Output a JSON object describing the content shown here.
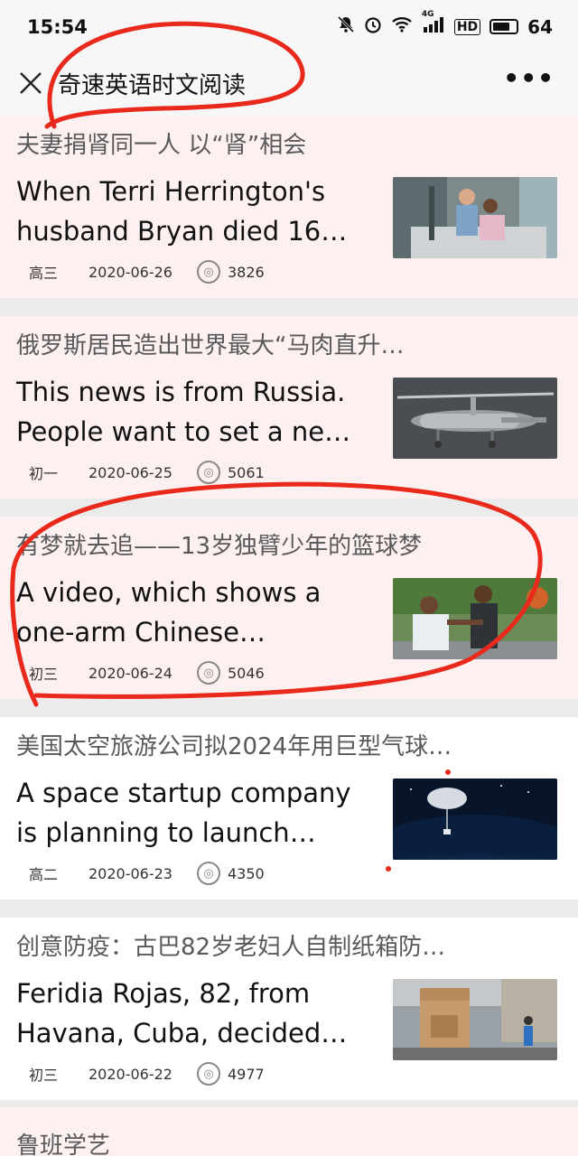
{
  "status": {
    "time": "15:54",
    "signal_label": "4G",
    "hd_label": "HD",
    "battery": "64"
  },
  "nav": {
    "title": "奇速英语时文阅读",
    "close": "×",
    "more": "•••"
  },
  "articles": [
    {
      "title": "夫妻捐肾同一人 以“肾”相会",
      "summary": "When Terri Herrington's husband Bryan died 16…",
      "grade": "高三",
      "date": "2020-06-26",
      "views": "3826"
    },
    {
      "title": "俄罗斯居民造出世界最大“马肉直升…",
      "summary": "This news is from Russia. People want to set a ne…",
      "grade": "初一",
      "date": "2020-06-25",
      "views": "5061"
    },
    {
      "title": "有梦就去追——13岁独臂少年的篮球梦",
      "summary": "A video, which shows a one-arm Chinese…",
      "grade": "初三",
      "date": "2020-06-24",
      "views": "5046"
    },
    {
      "title": "美国太空旅游公司拟2024年用巨型气球…",
      "summary": "A space startup company is planning to launch…",
      "grade": "高二",
      "date": "2020-06-23",
      "views": "4350"
    },
    {
      "title": "创意防疫：古巴82岁老妇人自制纸箱防…",
      "summary": "Feridia Rojas, 82, from Havana, Cuba, decided…",
      "grade": "初三",
      "date": "2020-06-22",
      "views": "4977"
    }
  ],
  "partial_article": {
    "title": "鲁班学艺"
  },
  "icons": {
    "close": "close-icon",
    "more": "more-icon",
    "views": "view-count-icon",
    "mute": "bell-off-icon",
    "alarm": "alarm-icon",
    "wifi": "wifi-icon"
  },
  "colors": {
    "pink_card": "#fdf0f0",
    "annotation_red": "#e8291c"
  }
}
